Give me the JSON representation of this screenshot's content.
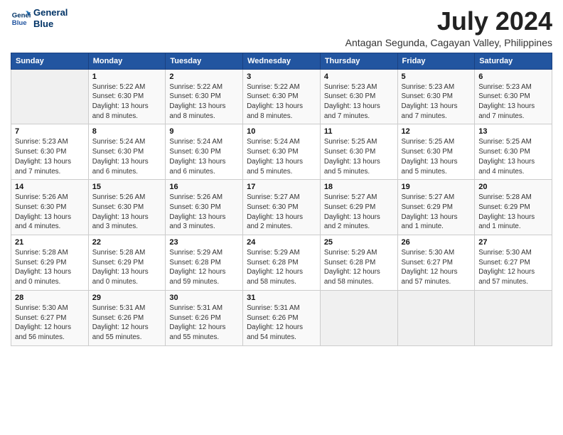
{
  "header": {
    "logo_line1": "General",
    "logo_line2": "Blue",
    "title": "July 2024",
    "subtitle": "Antagan Segunda, Cagayan Valley, Philippines"
  },
  "weekdays": [
    "Sunday",
    "Monday",
    "Tuesday",
    "Wednesday",
    "Thursday",
    "Friday",
    "Saturday"
  ],
  "weeks": [
    [
      {
        "num": "",
        "info": ""
      },
      {
        "num": "1",
        "info": "Sunrise: 5:22 AM\nSunset: 6:30 PM\nDaylight: 13 hours\nand 8 minutes."
      },
      {
        "num": "2",
        "info": "Sunrise: 5:22 AM\nSunset: 6:30 PM\nDaylight: 13 hours\nand 8 minutes."
      },
      {
        "num": "3",
        "info": "Sunrise: 5:22 AM\nSunset: 6:30 PM\nDaylight: 13 hours\nand 8 minutes."
      },
      {
        "num": "4",
        "info": "Sunrise: 5:23 AM\nSunset: 6:30 PM\nDaylight: 13 hours\nand 7 minutes."
      },
      {
        "num": "5",
        "info": "Sunrise: 5:23 AM\nSunset: 6:30 PM\nDaylight: 13 hours\nand 7 minutes."
      },
      {
        "num": "6",
        "info": "Sunrise: 5:23 AM\nSunset: 6:30 PM\nDaylight: 13 hours\nand 7 minutes."
      }
    ],
    [
      {
        "num": "7",
        "info": "Sunrise: 5:23 AM\nSunset: 6:30 PM\nDaylight: 13 hours\nand 7 minutes."
      },
      {
        "num": "8",
        "info": "Sunrise: 5:24 AM\nSunset: 6:30 PM\nDaylight: 13 hours\nand 6 minutes."
      },
      {
        "num": "9",
        "info": "Sunrise: 5:24 AM\nSunset: 6:30 PM\nDaylight: 13 hours\nand 6 minutes."
      },
      {
        "num": "10",
        "info": "Sunrise: 5:24 AM\nSunset: 6:30 PM\nDaylight: 13 hours\nand 5 minutes."
      },
      {
        "num": "11",
        "info": "Sunrise: 5:25 AM\nSunset: 6:30 PM\nDaylight: 13 hours\nand 5 minutes."
      },
      {
        "num": "12",
        "info": "Sunrise: 5:25 AM\nSunset: 6:30 PM\nDaylight: 13 hours\nand 5 minutes."
      },
      {
        "num": "13",
        "info": "Sunrise: 5:25 AM\nSunset: 6:30 PM\nDaylight: 13 hours\nand 4 minutes."
      }
    ],
    [
      {
        "num": "14",
        "info": "Sunrise: 5:26 AM\nSunset: 6:30 PM\nDaylight: 13 hours\nand 4 minutes."
      },
      {
        "num": "15",
        "info": "Sunrise: 5:26 AM\nSunset: 6:30 PM\nDaylight: 13 hours\nand 3 minutes."
      },
      {
        "num": "16",
        "info": "Sunrise: 5:26 AM\nSunset: 6:30 PM\nDaylight: 13 hours\nand 3 minutes."
      },
      {
        "num": "17",
        "info": "Sunrise: 5:27 AM\nSunset: 6:30 PM\nDaylight: 13 hours\nand 2 minutes."
      },
      {
        "num": "18",
        "info": "Sunrise: 5:27 AM\nSunset: 6:29 PM\nDaylight: 13 hours\nand 2 minutes."
      },
      {
        "num": "19",
        "info": "Sunrise: 5:27 AM\nSunset: 6:29 PM\nDaylight: 13 hours\nand 1 minute."
      },
      {
        "num": "20",
        "info": "Sunrise: 5:28 AM\nSunset: 6:29 PM\nDaylight: 13 hours\nand 1 minute."
      }
    ],
    [
      {
        "num": "21",
        "info": "Sunrise: 5:28 AM\nSunset: 6:29 PM\nDaylight: 13 hours\nand 0 minutes."
      },
      {
        "num": "22",
        "info": "Sunrise: 5:28 AM\nSunset: 6:29 PM\nDaylight: 13 hours\nand 0 minutes."
      },
      {
        "num": "23",
        "info": "Sunrise: 5:29 AM\nSunset: 6:28 PM\nDaylight: 12 hours\nand 59 minutes."
      },
      {
        "num": "24",
        "info": "Sunrise: 5:29 AM\nSunset: 6:28 PM\nDaylight: 12 hours\nand 58 minutes."
      },
      {
        "num": "25",
        "info": "Sunrise: 5:29 AM\nSunset: 6:28 PM\nDaylight: 12 hours\nand 58 minutes."
      },
      {
        "num": "26",
        "info": "Sunrise: 5:30 AM\nSunset: 6:27 PM\nDaylight: 12 hours\nand 57 minutes."
      },
      {
        "num": "27",
        "info": "Sunrise: 5:30 AM\nSunset: 6:27 PM\nDaylight: 12 hours\nand 57 minutes."
      }
    ],
    [
      {
        "num": "28",
        "info": "Sunrise: 5:30 AM\nSunset: 6:27 PM\nDaylight: 12 hours\nand 56 minutes."
      },
      {
        "num": "29",
        "info": "Sunrise: 5:31 AM\nSunset: 6:26 PM\nDaylight: 12 hours\nand 55 minutes."
      },
      {
        "num": "30",
        "info": "Sunrise: 5:31 AM\nSunset: 6:26 PM\nDaylight: 12 hours\nand 55 minutes."
      },
      {
        "num": "31",
        "info": "Sunrise: 5:31 AM\nSunset: 6:26 PM\nDaylight: 12 hours\nand 54 minutes."
      },
      {
        "num": "",
        "info": ""
      },
      {
        "num": "",
        "info": ""
      },
      {
        "num": "",
        "info": ""
      }
    ]
  ]
}
